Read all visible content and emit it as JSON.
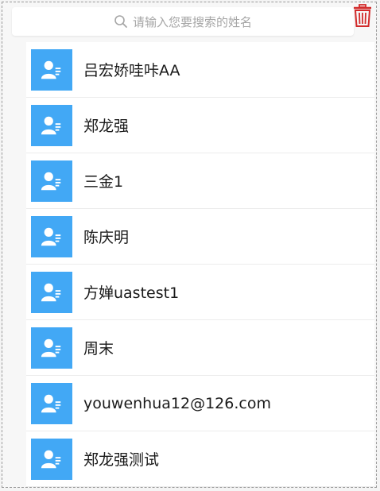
{
  "search": {
    "placeholder": "请输入您要搜索的姓名"
  },
  "contacts": [
    {
      "name": "吕宏娇哇咔AA"
    },
    {
      "name": "郑龙强"
    },
    {
      "name": "三金1"
    },
    {
      "name": "陈庆明"
    },
    {
      "name": "方婵uastest1"
    },
    {
      "name": "周末"
    },
    {
      "name": "youwenhua12@126.com"
    },
    {
      "name": "郑龙强测试"
    }
  ],
  "colors": {
    "avatar": "#42a8f5",
    "trash": "#d22b2b"
  }
}
